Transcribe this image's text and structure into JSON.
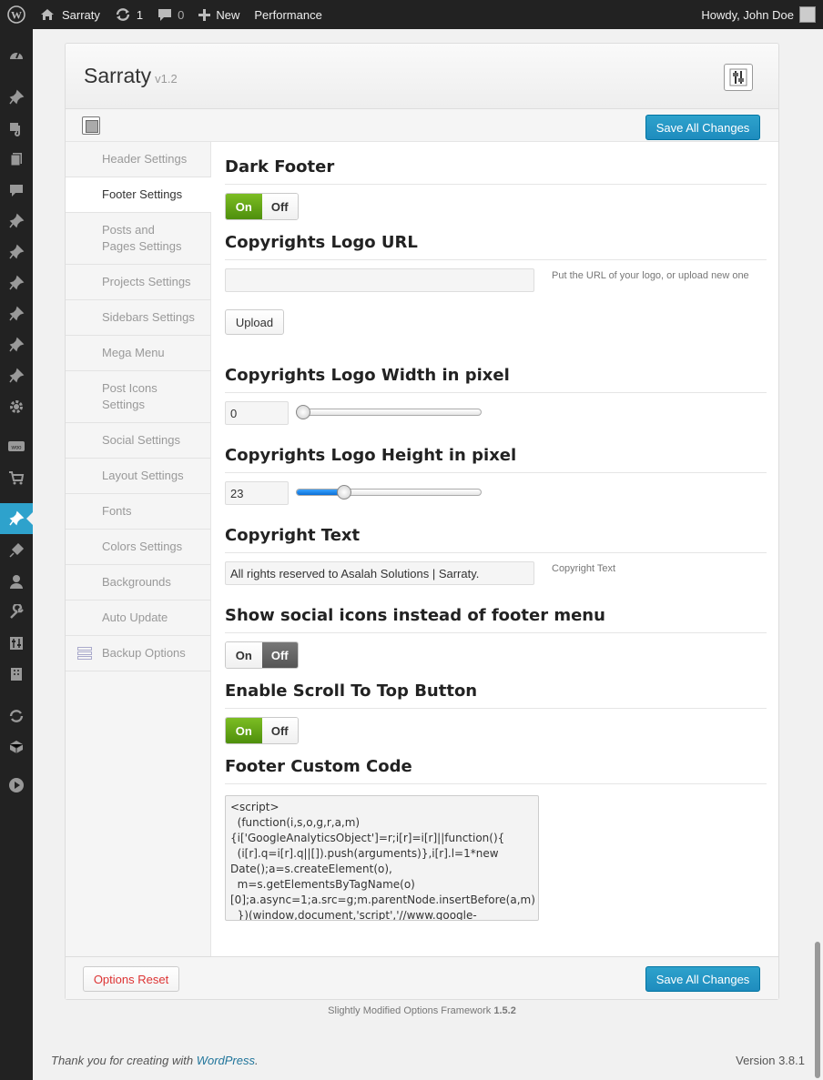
{
  "admin_bar": {
    "site_name": "Sarraty",
    "updates_count": "1",
    "comments_count": "0",
    "new_label": "New",
    "performance_label": "Performance",
    "greeting": "Howdy, John Doe"
  },
  "panel": {
    "title": "Sarraty",
    "version": "v1.2",
    "save_label": "Save All Changes",
    "reset_label": "Options Reset"
  },
  "tabs": [
    {
      "label": "Header Settings"
    },
    {
      "label": "Footer Settings"
    },
    {
      "label": "Posts and Pages Settings"
    },
    {
      "label": "Projects Settings"
    },
    {
      "label": "Sidebars Settings"
    },
    {
      "label": "Mega Menu"
    },
    {
      "label": "Post Icons Settings"
    },
    {
      "label": "Social Settings"
    },
    {
      "label": "Layout Settings"
    },
    {
      "label": "Fonts"
    },
    {
      "label": "Colors Settings"
    },
    {
      "label": "Backgrounds"
    },
    {
      "label": "Auto Update"
    },
    {
      "label": "Backup Options"
    }
  ],
  "active_tab": "Footer Settings",
  "toggle_labels": {
    "on": "On",
    "off": "Off"
  },
  "fields": {
    "dark_footer": {
      "title": "Dark Footer",
      "value": "On"
    },
    "logo_url": {
      "title": "Copyrights Logo URL",
      "value": "",
      "explain": "Put the URL of your logo, or upload new one",
      "upload_label": "Upload"
    },
    "logo_width": {
      "title": "Copyrights Logo Width in pixel",
      "value": "0",
      "slider_fraction": 0.0
    },
    "logo_height": {
      "title": "Copyrights Logo Height in pixel",
      "value": "23",
      "slider_fraction": 0.23
    },
    "copyright_text": {
      "title": "Copyright Text",
      "value": "All rights reserved to Asalah Solutions | Sarraty.",
      "explain": "Copyright Text"
    },
    "social_icons": {
      "title": "Show social icons instead of footer menu",
      "value": "Off"
    },
    "scroll_top": {
      "title": "Enable Scroll To Top Button",
      "value": "On"
    },
    "custom_code": {
      "title": "Footer Custom Code",
      "value": "<script>\n  (function(i,s,o,g,r,a,m){i['GoogleAnalyticsObject']=r;i[r]=i[r]||function(){\n  (i[r].q=i[r].q||[]).push(arguments)},i[r].l=1*new Date();a=s.createElement(o),\n  m=s.getElementsByTagName(o)[0];a.async=1;a.src=g;m.parentNode.insertBefore(a,m)\n  })(window,document,'script','//www.google-analytics.com/analytics.js','ga');"
    }
  },
  "framework_text": "Slightly Modified Options Framework",
  "framework_version": "1.5.2",
  "footer": {
    "thanks_prefix": "Thank you for creating with",
    "thanks_link": "WordPress",
    "thanks_suffix": ".",
    "version": "Version 3.8.1"
  },
  "colors": {
    "accent": "#2ea2cc",
    "on_green": "#5a9a10",
    "reset_red": "#dd3333"
  }
}
